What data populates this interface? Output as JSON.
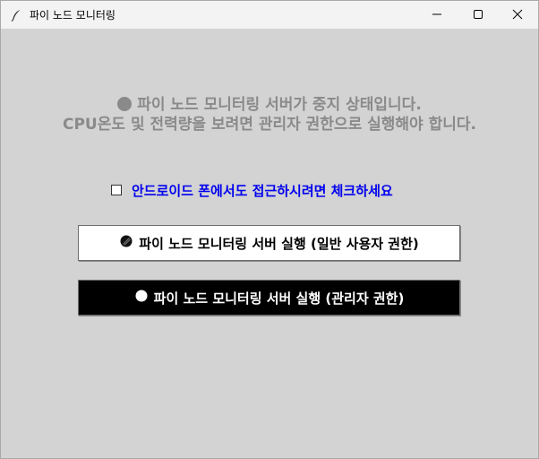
{
  "window": {
    "title": "파이 노드 모니터링",
    "app_icon": "feather-icon",
    "controls": [
      "minimize-icon",
      "maximize-icon",
      "close-icon"
    ]
  },
  "status": {
    "line1": "파이 노드 모니터링 서버가 중지 상태입니다.",
    "line2": "CPU온도 및 전력량을 보려면 관리자 권한으로 실행해야 합니다.",
    "indicator_color": "#8a8a8a"
  },
  "android_option": {
    "label": "안드로이드 폰에서도 접근하시려면 체크하세요",
    "checked": false,
    "label_color": "#0000ee"
  },
  "buttons": {
    "run_user": {
      "label": "파이 노드 모니터링 서버 실행 (일반 사용자 권한)",
      "icon": "user-icon"
    },
    "run_admin": {
      "label": "파이 노드 모니터링 서버 실행 (관리자 권한)",
      "icon": "admin-dot-icon"
    }
  },
  "colors": {
    "background": "#d3d3d3",
    "titlebar": "#f3f3f3",
    "admin_button_bg": "#000000",
    "user_button_bg": "#ffffff"
  }
}
